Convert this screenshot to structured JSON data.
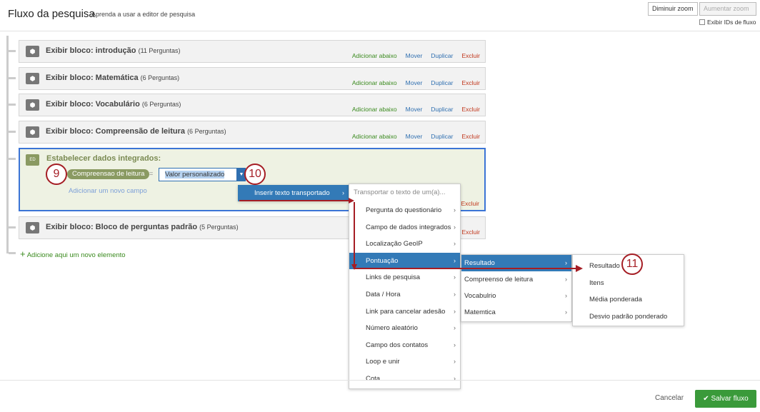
{
  "header": {
    "title": "Fluxo da pesquisa",
    "subtitle": "Aprenda a usar a editor de pesquisa",
    "zoom_out": "Diminuir zoom",
    "zoom_in": "Aumentar zoom",
    "show_ids": "Exibir IDs de fluxo"
  },
  "actions": {
    "add_below": "Adicionar abaixo",
    "move": "Mover",
    "duplicate": "Duplicar",
    "delete": "Excluir"
  },
  "blocks": [
    {
      "name": "Exibir bloco: introdução",
      "count": "(11 Perguntas)"
    },
    {
      "name": "Exibir bloco: Matemática",
      "count": "(6 Perguntas)"
    },
    {
      "name": "Exibir bloco: Vocabulário",
      "count": "(6 Perguntas)"
    },
    {
      "name": "Exibir bloco: Compreensão de leitura",
      "count": "(6 Perguntas)"
    },
    {
      "name": "Exibir bloco: Bloco de perguntas padrão",
      "count": "(5 Perguntas)"
    }
  ],
  "embedded": {
    "icon": "ED",
    "title": "Estabelecer dados integrados:",
    "field": "Compreensao de leitura",
    "equals": "=",
    "value": "Valor personalizado",
    "add_field": "Adicionar um novo campo"
  },
  "add_element": "Adicione aqui um novo elemento",
  "menu1": {
    "label": "Inserir texto transportado"
  },
  "menu2": {
    "header": "Transportar o texto de um(a)...",
    "items": [
      "Pergunta do questionário",
      "Campo de dados integrados",
      "Localização GeoIP",
      "Pontuação",
      "Links de pesquisa",
      "Data / Hora",
      "Link para cancelar adesão",
      "Número aleatório",
      "Campo dos contatos",
      "Loop e unir",
      "Cota"
    ]
  },
  "menu3": {
    "items": [
      "Resultado",
      "Compreenso de leitura",
      "Vocabulrio",
      "Matemtica"
    ]
  },
  "menu4": {
    "items": [
      "Resultado",
      "Itens",
      "Média ponderada",
      "Desvio padrão ponderado"
    ]
  },
  "annotations": [
    "9",
    "10",
    "11"
  ],
  "footer": {
    "cancel": "Cancelar",
    "save": "Salvar fluxo"
  }
}
